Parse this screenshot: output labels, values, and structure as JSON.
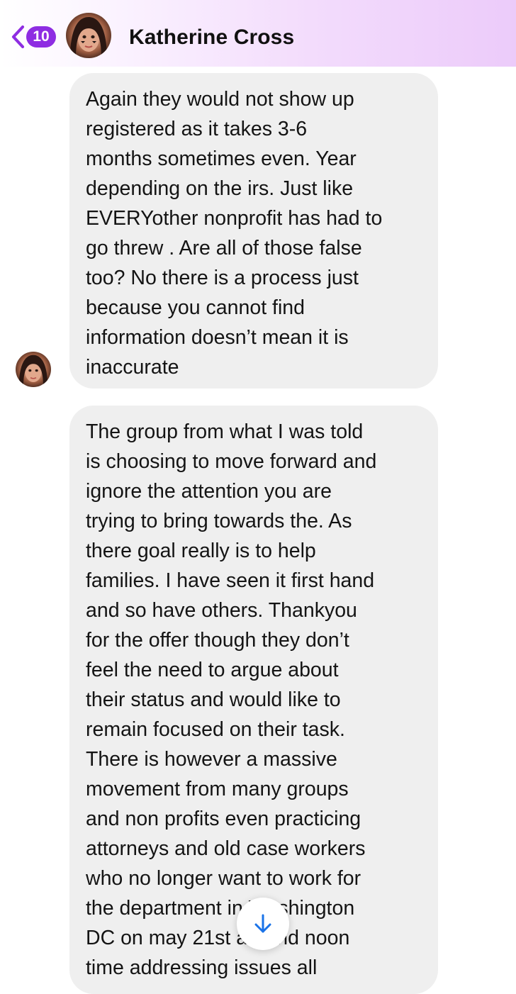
{
  "header": {
    "back_badge_count": "10",
    "contact_name": "Katherine Cross"
  },
  "messages": [
    {
      "sender": "Katherine Cross",
      "text": "Again they would not show up\nregistered as it takes 3-6\nmonths sometimes even. Year\ndepending on the irs. Just like\nEVERYother nonprofit has had to\ngo threw . Are all of those false\ntoo? No there is a process just\nbecause you cannot find\ninformation doesn’t mean it is\ninaccurate"
    },
    {
      "sender": "Katherine Cross",
      "text": "The group from what I was told\nis choosing to move forward and\nignore the attention you are\ntrying to bring towards the. As\nthere goal really is to help\nfamilies. I have seen it first hand\nand so have others. Thankyou\nfor the offer though they don’t\nfeel the need to argue about\ntheir status and would like to\nremain focused on their task.\nThere is however a massive\nmovement from many groups\nand non profits even practicing\nattorneys and old case workers\nwho no longer want to work for\nthe department in Washington\nDC on may 21st around noon\ntime addressing issues all"
    }
  ],
  "icons": {
    "back": "chevron-left-icon",
    "scroll_down": "arrow-down-icon"
  },
  "colors": {
    "accent": "#8e2de2",
    "bubble": "#efefef",
    "scroll_arrow": "#1a73e8"
  }
}
